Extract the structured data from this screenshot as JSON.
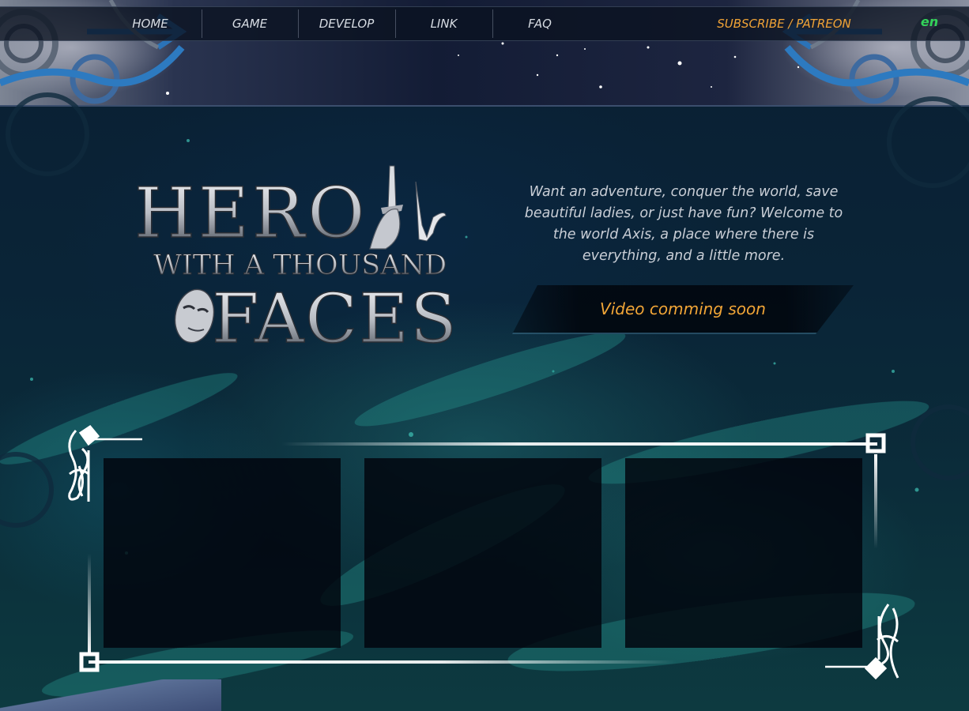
{
  "nav": {
    "items": [
      {
        "label": "HOME"
      },
      {
        "label": "GAME"
      },
      {
        "label": "DEVELOP"
      },
      {
        "label": "LINK"
      },
      {
        "label": "FAQ"
      }
    ],
    "subscribe_label": "SUBSCRIBE / PATREON",
    "language": "en"
  },
  "logo": {
    "line1": "HERO",
    "line2": "WITH A THOUSAND",
    "line3": "FACES"
  },
  "intro": {
    "text": "Want an adventure, conquer the world, save beautiful ladies, or just have fun? Welcome to the world Axis, a place where there is everything, and a little more."
  },
  "video": {
    "label": "Video comming soon"
  },
  "panels": [
    {
      "name": "panel-1"
    },
    {
      "name": "panel-2"
    },
    {
      "name": "panel-3"
    }
  ],
  "colors": {
    "accent_orange": "#f2a637",
    "lang_green": "#33d35a",
    "nav_text": "#d7dce3",
    "background": "#0a2437"
  }
}
